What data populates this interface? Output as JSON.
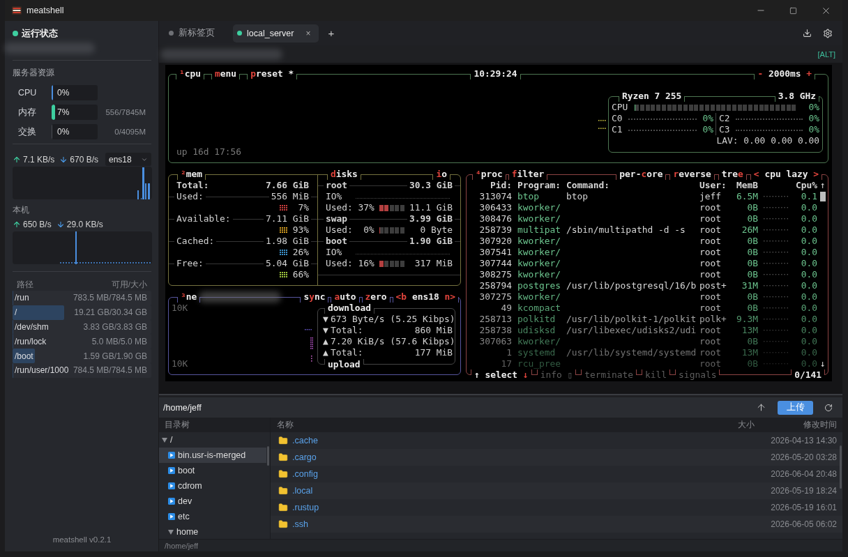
{
  "window": {
    "title": "meatshell"
  },
  "sidebar": {
    "status": {
      "label": "运行状态",
      "online": true
    },
    "resources_title": "服务器资源",
    "resources": [
      {
        "label": "CPU",
        "reading": "0%",
        "level": 0.03,
        "color": "#4a8fe0"
      },
      {
        "label": "内存",
        "reading": "7%",
        "level": 0.07,
        "detail": "556/7845M",
        "color": "#3ecfa0"
      },
      {
        "label": "交换",
        "reading": "0%",
        "level": 0,
        "detail": "0/4095M"
      }
    ],
    "traffic": {
      "up": "7.1 KB/s",
      "down": "670 B/s",
      "interface": "ens18"
    },
    "local_title": "本机",
    "local_traffic": {
      "up": "650 B/s",
      "down": "29.0 KB/s"
    },
    "mounts_header": {
      "path": "路径",
      "usage": "可用/大小"
    },
    "mounts": [
      {
        "path": "/run",
        "usage": "783.5 MB/784.5 MB",
        "level": 0
      },
      {
        "path": "/",
        "usage": "19.21 GB/30.34 GB",
        "level": 0.37
      },
      {
        "path": "/dev/shm",
        "usage": "3.83 GB/3.83 GB",
        "level": 0
      },
      {
        "path": "/run/lock",
        "usage": "5.0 MB/5.0 MB",
        "level": 0
      },
      {
        "path": "/boot",
        "usage": "1.59 GB/1.90 GB",
        "level": 0.16
      },
      {
        "path": "/run/user/1000",
        "usage": "784.5 MB/784.5 MB",
        "level": 0
      }
    ],
    "version": "meatshell v0.2.1"
  },
  "tabs": [
    {
      "label": "新标签页",
      "selected": false,
      "connected": false
    },
    {
      "label": "local_server",
      "selected": true,
      "connected": true,
      "close": "×"
    }
  ],
  "new_tab": "+",
  "alt_hint": "[ALT]",
  "terminal": {
    "cpu": {
      "titles": [
        {
          "parts": [
            {
              "text": "¹",
              "hot": true
            },
            {
              "text": "cpu",
              "hot": false
            }
          ]
        },
        {
          "parts": [
            {
              "text": "m",
              "hot": true
            },
            {
              "text": "enu",
              "hot": false
            }
          ]
        },
        {
          "parts": [
            {
              "text": "p",
              "hot": true
            },
            {
              "text": "reset *",
              "hot": false
            }
          ]
        }
      ],
      "clock": "10:29:24",
      "interval": {
        "parts": [
          {
            "text": "-",
            "hot": true
          },
          {
            "text": " 2000ms ",
            "hot": false
          },
          {
            "text": "+",
            "hot": true
          }
        ]
      },
      "uptime": "up 16d 17:56",
      "model": "Ryzen 7 255",
      "frequency": "3.8 GHz",
      "total": {
        "label": "CPU",
        "level": 0,
        "reading": "0%"
      },
      "cores": [
        {
          "label": "C0",
          "reading": "0%"
        },
        {
          "label": "C2",
          "reading": "0%"
        },
        {
          "label": "C1",
          "reading": "0%"
        },
        {
          "label": "C3",
          "reading": "0%"
        }
      ],
      "load": "LAV: 0.00 0.00 0.00"
    },
    "mem": {
      "title": {
        "parts": [
          {
            "text": "²",
            "hot": true
          },
          {
            "text": "mem",
            "hot": false
          }
        ]
      },
      "rows": [
        {
          "kind": "total",
          "label": "Total:",
          "value": "7.66 GiB"
        },
        {
          "kind": "value",
          "label": "Used:",
          "value": "556 MiB"
        },
        {
          "kind": "meter",
          "color": "#c83c3c",
          "reading": "7%"
        },
        {
          "kind": "value",
          "label": "Available:",
          "value": "7.11 GiB"
        },
        {
          "kind": "meter",
          "color": "#d8a020",
          "reading": "93%"
        },
        {
          "kind": "value",
          "label": "Cached:",
          "value": "1.98 GiB"
        },
        {
          "kind": "meter",
          "color": "#3a90c8",
          "reading": "26%"
        },
        {
          "kind": "value",
          "label": "Free:",
          "value": "5.04 GiB"
        },
        {
          "kind": "meter",
          "color": "#9cc43c",
          "reading": "66%"
        }
      ]
    },
    "disks": {
      "title": {
        "parts": [
          {
            "text": "d",
            "hot": true
          },
          {
            "text": "isks",
            "hot": false
          }
        ]
      },
      "io_title": {
        "parts": [
          {
            "text": "i",
            "hot": true
          },
          {
            "text": "o",
            "hot": false
          }
        ]
      },
      "rows": [
        {
          "kind": "disk",
          "label": "root",
          "value": "30.3 GiB"
        },
        {
          "kind": "io",
          "label": "IO%"
        },
        {
          "kind": "usage",
          "label": "Used:",
          "percent": "37%",
          "level": 0.37,
          "value": "11.1 GiB"
        },
        {
          "kind": "disk",
          "label": "swap",
          "value": "3.99 GiB"
        },
        {
          "kind": "usage",
          "label": "Used:",
          "percent": "0%",
          "level": 0,
          "value": "0 Byte"
        },
        {
          "kind": "disk",
          "label": "boot",
          "value": "1.90 GiB"
        },
        {
          "kind": "io",
          "label": "IO%"
        },
        {
          "kind": "usage",
          "label": "Used:",
          "percent": "16%",
          "level": 0.16,
          "value": "317 MiB"
        }
      ]
    },
    "net": {
      "title": {
        "parts": [
          {
            "text": "³",
            "hot": true
          },
          {
            "text": "ne",
            "hot": false
          }
        ]
      },
      "options": [
        {
          "parts": [
            {
              "text": "s",
              "hot": false
            },
            {
              "text": "y",
              "hot": true
            },
            {
              "text": "nc",
              "hot": false
            }
          ]
        },
        {
          "parts": [
            {
              "text": "a",
              "hot": true
            },
            {
              "text": "uto",
              "hot": false
            }
          ]
        },
        {
          "parts": [
            {
              "text": "z",
              "hot": true
            },
            {
              "text": "ero",
              "hot": false
            }
          ]
        },
        {
          "parts": [
            {
              "text": "<b",
              "hot": true
            },
            {
              "text": " ens18 ",
              "hot": false
            },
            {
              "text": "n>",
              "hot": true
            }
          ]
        }
      ],
      "scale_top": "10K",
      "scale_bottom": "10K",
      "download_title": "download",
      "upload_title": "upload",
      "rows": [
        {
          "arrow": "▼",
          "label": "673 Byte/s (5.25 Kibps)"
        },
        {
          "arrow": "▼",
          "label": "Total:",
          "value": "860 MiB"
        },
        {
          "arrow": "▲",
          "label": "7.20 KiB/s (57.6 Kibps)"
        },
        {
          "arrow": "▲",
          "label": "Total:",
          "value": "177 MiB"
        }
      ]
    },
    "proc": {
      "titles": [
        {
          "parts": [
            {
              "text": "⁴",
              "hot": true
            },
            {
              "text": "proc",
              "hot": false
            }
          ]
        },
        {
          "parts": [
            {
              "text": "f",
              "hot": true
            },
            {
              "text": "ilter",
              "hot": false
            }
          ]
        }
      ],
      "options": [
        {
          "parts": [
            {
              "text": "per-",
              "hot": false
            },
            {
              "text": "c",
              "hot": true
            },
            {
              "text": "ore",
              "hot": false
            }
          ]
        },
        {
          "parts": [
            {
              "text": "r",
              "hot": true
            },
            {
              "text": "everse",
              "hot": false
            }
          ]
        },
        {
          "parts": [
            {
              "text": "tre",
              "hot": false
            },
            {
              "text": "e",
              "hot": true
            }
          ]
        },
        {
          "parts": [
            {
              "text": "<",
              "hot": true
            },
            {
              "text": " cpu lazy ",
              "hot": false
            },
            {
              "text": ">",
              "hot": true
            }
          ]
        }
      ],
      "columns": [
        "Pid:",
        "Program:",
        "Command:",
        "User:",
        "MemB",
        "Cpu%"
      ],
      "scroll_up": "↑",
      "scroll_down": "↓",
      "rows": [
        {
          "pid": "313074",
          "program": "btop",
          "command": "btop",
          "user": "jeff",
          "mem": "6.5M",
          "cpu": "0.1"
        },
        {
          "pid": "306433",
          "program": "kworker/",
          "user": "root",
          "mem": "0B",
          "cpu": "0.0"
        },
        {
          "pid": "308476",
          "program": "kworker/",
          "user": "root",
          "mem": "0B",
          "cpu": "0.0"
        },
        {
          "pid": "258739",
          "program": "multipat",
          "command": "/sbin/multipathd -d -s",
          "user": "root",
          "mem": "26M",
          "cpu": "0.0"
        },
        {
          "pid": "307920",
          "program": "kworker/",
          "user": "root",
          "mem": "0B",
          "cpu": "0.0"
        },
        {
          "pid": "307541",
          "program": "kworker/",
          "user": "root",
          "mem": "0B",
          "cpu": "0.0"
        },
        {
          "pid": "307744",
          "program": "kworker/",
          "user": "root",
          "mem": "0B",
          "cpu": "0.0"
        },
        {
          "pid": "308275",
          "program": "kworker/",
          "user": "root",
          "mem": "0B",
          "cpu": "0.0"
        },
        {
          "pid": "258794",
          "program": "postgres",
          "command": "/usr/lib/postgresql/16/b",
          "user": "post+",
          "mem": "31M",
          "cpu": "0.0"
        },
        {
          "pid": "307275",
          "program": "kworker/",
          "user": "root",
          "mem": "0B",
          "cpu": "0.0"
        },
        {
          "pid": "49",
          "program": "kcompact",
          "user": "root",
          "mem": "0B",
          "cpu": "0.0"
        },
        {
          "pid": "258713",
          "program": "polkitd",
          "command": "/usr/lib/polkit-1/polkit",
          "user": "polk+",
          "mem": "9.3M",
          "cpu": "0.0"
        },
        {
          "pid": "258738",
          "program": "udisksd",
          "command": "/usr/libexec/udisks2/udi",
          "user": "root",
          "mem": "13M",
          "cpu": "0.0"
        },
        {
          "pid": "307063",
          "program": "kworker/",
          "user": "root",
          "mem": "0B",
          "cpu": "0.0"
        },
        {
          "pid": "1",
          "program": "systemd",
          "command": "/usr/lib/systemd/systemd",
          "user": "root",
          "mem": "13M",
          "cpu": "0.0"
        },
        {
          "pid": "17",
          "program": "rcu_pree",
          "user": "root",
          "mem": "0B",
          "cpu": "0.0"
        }
      ],
      "footer": [
        {
          "parts": [
            {
              "text": "↑ ",
              "hot": false
            },
            {
              "text": "select ",
              "hot": false
            },
            {
              "text": "↓",
              "hot": true
            }
          ],
          "disabled": false
        },
        {
          "parts": [
            {
              "text": "info ▯",
              "hot": false
            }
          ],
          "disabled": true
        },
        {
          "parts": [
            {
              "text": "terminate",
              "hot": false
            }
          ],
          "disabled": true
        },
        {
          "parts": [
            {
              "text": "kill",
              "hot": false
            }
          ],
          "disabled": true
        },
        {
          "parts": [
            {
              "text": "signals",
              "hot": false
            }
          ],
          "disabled": true
        }
      ],
      "count": "0/141"
    }
  },
  "file_browser": {
    "path": "/home/jeff",
    "upload": "上传",
    "tree_title": "目录树",
    "columns": {
      "name": "名称",
      "size": "大小",
      "modified": "修改时间"
    },
    "tree": [
      {
        "name": "/",
        "expanded": true,
        "selected": false,
        "children": [
          {
            "name": "bin.usr-is-merged",
            "expanded": false,
            "selected": true
          },
          {
            "name": "boot",
            "expanded": false,
            "selected": false
          },
          {
            "name": "cdrom",
            "expanded": false,
            "selected": false
          },
          {
            "name": "dev",
            "expanded": false,
            "selected": false
          },
          {
            "name": "etc",
            "expanded": false,
            "selected": false
          },
          {
            "name": "home",
            "expanded": true,
            "selected": false
          }
        ]
      }
    ],
    "files": [
      {
        "name": ".cache",
        "modified": "2026-04-13 14:30"
      },
      {
        "name": ".cargo",
        "modified": "2026-05-20 03:28"
      },
      {
        "name": ".config",
        "modified": "2026-06-04 20:48"
      },
      {
        "name": ".local",
        "modified": "2026-05-19 18:24"
      },
      {
        "name": ".rustup",
        "modified": "2026-05-19 16:01"
      },
      {
        "name": ".ssh",
        "modified": "2026-06-05 06:02"
      }
    ],
    "status": "/home/jeff"
  }
}
